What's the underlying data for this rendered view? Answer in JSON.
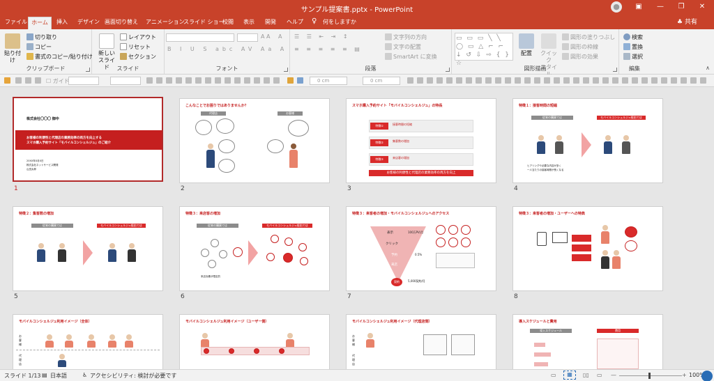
{
  "window": {
    "title": "サンプル提案書.pptx  -  PowerPoint",
    "share": "共有"
  },
  "tabs": [
    {
      "label": "ファイル"
    },
    {
      "label": "ホーム"
    },
    {
      "label": "挿入"
    },
    {
      "label": "デザイン"
    },
    {
      "label": "画面切り替え"
    },
    {
      "label": "アニメーション"
    },
    {
      "label": "スライド ショー"
    },
    {
      "label": "校閲"
    },
    {
      "label": "表示"
    },
    {
      "label": "開発"
    },
    {
      "label": "ヘルプ"
    },
    {
      "label": "何をしますか"
    }
  ],
  "ribbon": {
    "clipboard": {
      "label": "クリップボード",
      "paste": "貼り付け",
      "cut": "切り取り",
      "copy": "コピー",
      "format_painter": "書式のコピー/貼り付け"
    },
    "slides": {
      "label": "スライド",
      "new_slide": "新しい",
      "new_slide2": "スライド",
      "layout": "レイアウト",
      "reset": "リセット",
      "section": "セクション"
    },
    "font": {
      "label": "フォント"
    },
    "paragraph": {
      "label": "段落",
      "text_direction": "文字列の方向",
      "align_text": "文字の配置",
      "smartart": "SmartArt に変換"
    },
    "drawing": {
      "label": "図形描画",
      "arrange": "配置",
      "quick_styles": "クイック",
      "quick_styles2": "スタイル",
      "shape_fill": "図形の塗りつぶし",
      "shape_outline": "図形の枠線",
      "shape_effects": "図形の効果"
    },
    "editing": {
      "label": "編集",
      "find": "検索",
      "replace": "置換",
      "select": "選択"
    }
  },
  "qat": {
    "guide": "ガイド",
    "cm1": "0 cm",
    "cm2": "0 cm"
  },
  "slides": [
    {
      "num": "1",
      "title": "株式会社〇〇〇 御中",
      "line1": "お客様の利便性と代理店の業務効率の両方を向上する",
      "line2": "スマホ購入予約サイト「モバイルコンシェルジュ」のご紹介",
      "foot1": "20XX年X月X日",
      "foot2": "株式会社ネットサービス開発",
      "foot3": "山田太郎"
    },
    {
      "num": "2",
      "title": "こんなことでお困りではありませんか？",
      "a": "代理店",
      "b": "お客様"
    },
    {
      "num": "3",
      "title": "スマホ購入予約サイト「モバイルコンシェルジュ」の特長",
      "f1": "特徴①",
      "f1t": "接客時間の短縮",
      "f2": "特徴②",
      "f2t": "集客数の増加",
      "f3": "特徴③",
      "f3t": "来店客の増加",
      "band": "お客様の利便性と代理店の業務効率の両方を向上"
    },
    {
      "num": "4",
      "title": "特徴１：接客時間の短縮",
      "a": "従来の購買では",
      "b": "モバイルコンシェルジュ経由では",
      "c": "ヒアリングや必要な内容が多く",
      "d": "一人当たりの接客時間が長くなる"
    },
    {
      "num": "5",
      "title": "特徴２：集客数の増加",
      "a": "従来の購買では",
      "b": "モバイルコンシェルジュ経由では"
    },
    {
      "num": "6",
      "title": "特徴３：来店客の増加",
      "a": "従来の購買では",
      "b": "モバイルコンシェルジュ経由では",
      "c": "来店効果が限定的"
    },
    {
      "num": "7",
      "title": "特徴３：来客者の増加・モバイルコンシェルジュへのアクセス",
      "l1": "表示",
      "l2": "クリック",
      "l3": "予約",
      "l4": "来店",
      "l5": "契約",
      "v1": "100万PV/月",
      "v2": "0.5%",
      "v3": "5,000契約/月"
    },
    {
      "num": "8",
      "title": "特徴３：来客者の増加・ユーザーへの特典"
    },
    {
      "num": "9",
      "title": "モバイルコンシェルジュ利用イメージ（全体）",
      "r1": "お客様",
      "r2": "代理店"
    },
    {
      "num": "10",
      "title": "モバイルコンシェルジュ利用イメージ（ユーザー側）"
    },
    {
      "num": "11",
      "title": "モバイルコンシェルジュ利用イメージ（代理店側）",
      "r1": "お客様",
      "r2": "代理店"
    },
    {
      "num": "12",
      "title": "導入スケジュールと費用",
      "a": "導入スケジュール",
      "b": "費用"
    }
  ],
  "status": {
    "slide": "スライド 1/13",
    "lang": "日本語",
    "accessibility": "アクセシビリティ: 検討が必要です",
    "zoom": "100%"
  }
}
